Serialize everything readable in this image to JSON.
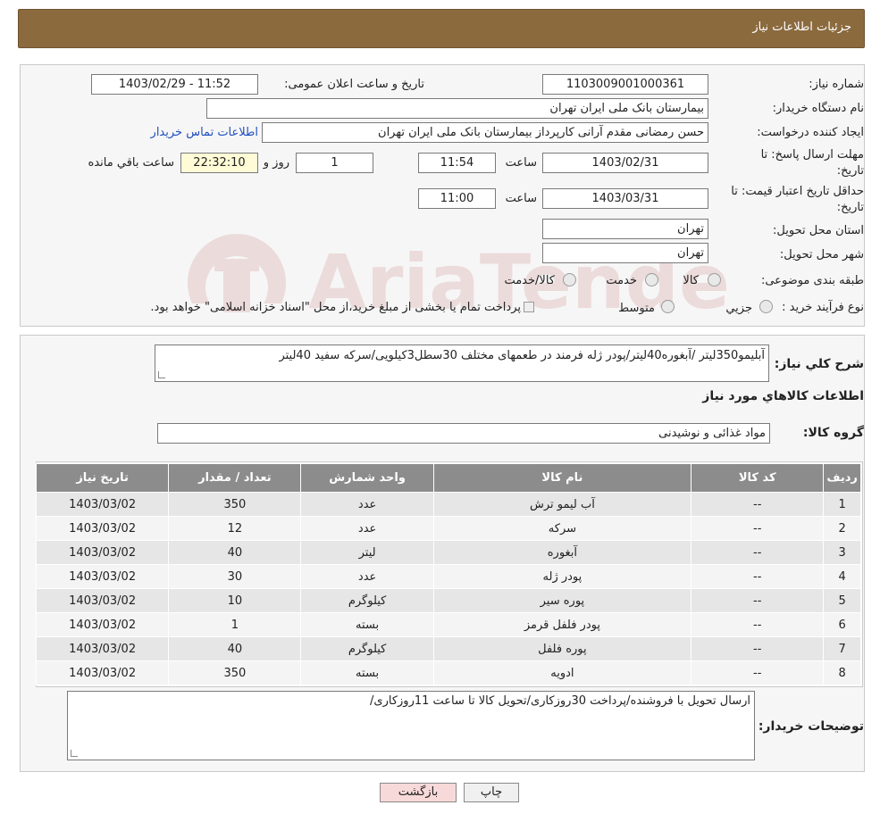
{
  "header": {
    "title": "جزئیات اطلاعات نیاز"
  },
  "fields": {
    "need_number_label": "شماره نیاز:",
    "need_number": "1103009001000361",
    "announce_label": "تاریخ و ساعت اعلان عمومی:",
    "announce_value": "1403/02/29 - 11:52",
    "buyer_org_label": "نام دستگاه خریدار:",
    "buyer_org": "بیمارستان بانک ملی ایران تهران",
    "creator_label": "ایجاد کننده درخواست:",
    "creator": "حسن رمضانی مقدم آرانی کارپرداز بیمارستان بانک ملی ایران تهران",
    "contact_link": "اطلاعات تماس خریدار",
    "deadline_label_1": "مهلت ارسال پاسخ: تا",
    "deadline_label_2": "تاریخ:",
    "deadline_date": "1403/02/31",
    "time_label": "ساعت",
    "deadline_time": "11:54",
    "days_value": "1",
    "days_label": "روز و",
    "remaining_time": "22:32:10",
    "remaining_label": "ساعت باقي مانده",
    "validity_label_1": "حداقل تاریخ اعتبار قیمت: تا",
    "validity_label_2": "تاریخ:",
    "validity_date": "1403/03/31",
    "validity_time": "11:00",
    "province_label": "استان محل تحویل:",
    "province": "تهران",
    "city_label": "شهر محل تحویل:",
    "city": "تهران",
    "category_label": "طبقه بندی موضوعی:",
    "category_options": [
      "کالا",
      "خدمت",
      "کالا/خدمت"
    ],
    "process_label": "نوع فرآیند خرید :",
    "process_options": [
      "جزیي",
      "متوسط"
    ],
    "process_note": "پرداخت تمام یا بخشی از مبلغ خرید،از محل \"اسناد خزانه اسلامی\" خواهد بود."
  },
  "description": {
    "label": "شرح کلي نیاز:",
    "text": "آبلیمو350لیتر /آبغوره40لیتر/پودر ژله فرمند در طعمهای مختلف 30سطل3کیلویی/سرکه سفید 40لیتر"
  },
  "goods": {
    "section_title": "اطلاعات کالاهاي مورد نیاز",
    "group_label": "گروه کالا:",
    "group_value": "مواد غذائی و نوشیدنی",
    "columns": [
      "ردیف",
      "کد کالا",
      "نام کالا",
      "واحد شمارش",
      "تعداد / مقدار",
      "تاریخ نیاز"
    ],
    "rows": [
      [
        "1",
        "--",
        "آب لیمو ترش",
        "عدد",
        "350",
        "1403/03/02"
      ],
      [
        "2",
        "--",
        "سرکه",
        "عدد",
        "12",
        "1403/03/02"
      ],
      [
        "3",
        "--",
        "آبغوره",
        "لیتر",
        "40",
        "1403/03/02"
      ],
      [
        "4",
        "--",
        "پودر ژله",
        "عدد",
        "30",
        "1403/03/02"
      ],
      [
        "5",
        "--",
        "پوره سیر",
        "کیلوگرم",
        "10",
        "1403/03/02"
      ],
      [
        "6",
        "--",
        "پودر فلفل قرمز",
        "بسته",
        "1",
        "1403/03/02"
      ],
      [
        "7",
        "--",
        "پوره فلفل",
        "کیلوگرم",
        "40",
        "1403/03/02"
      ],
      [
        "8",
        "--",
        "ادویه",
        "بسته",
        "350",
        "1403/03/02"
      ]
    ]
  },
  "buyer_notes": {
    "label": "توضیحات خریدار:",
    "text": "ارسال تحویل با فروشنده/پرداخت 30روزکاری/تحویل کالا تا ساعت 11روزکاری/"
  },
  "buttons": {
    "print": "چاپ",
    "back": "بازگشت"
  },
  "watermark": {
    "text": "AriaTender.neT"
  },
  "colors": {
    "header": "#8b6a3e",
    "table_header": "#8c8c8c",
    "link": "#1f4fbf",
    "back_button": "#f8d9d9"
  }
}
